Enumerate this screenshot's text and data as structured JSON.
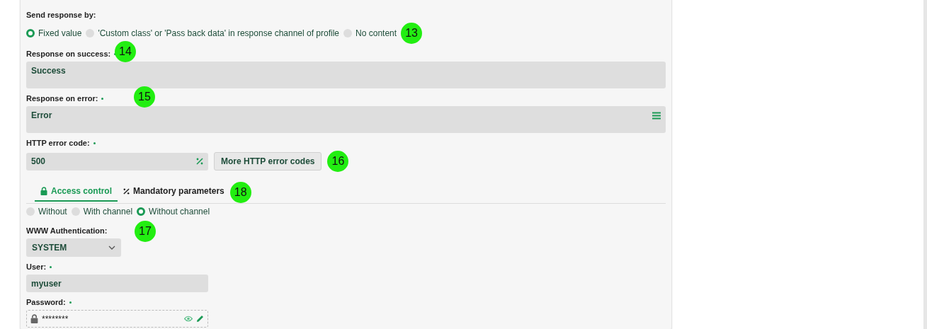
{
  "send_response": {
    "label": "Send response by:",
    "options": [
      {
        "label": "Fixed value",
        "selected": true
      },
      {
        "label": "'Custom class' or 'Pass back data' in response channel of profile",
        "selected": false
      },
      {
        "label": "No content",
        "selected": false
      }
    ]
  },
  "response_success": {
    "label": "Response on success:",
    "required": true,
    "value": "Success"
  },
  "response_error": {
    "label": "Response on error:",
    "required": true,
    "value": "Error"
  },
  "http_error_code": {
    "label": "HTTP error code:",
    "required": true,
    "value": "500",
    "button": "More HTTP error codes"
  },
  "tabs": [
    {
      "label": "Access control",
      "selected": true,
      "kind": "lock"
    },
    {
      "label": "Mandatory parameters",
      "selected": false,
      "kind": "percent"
    }
  ],
  "access_options": [
    {
      "label": "Without",
      "selected": false
    },
    {
      "label": "With channel",
      "selected": false
    },
    {
      "label": "Without channel",
      "selected": true
    }
  ],
  "www_auth": {
    "label": "WWW Authentication:",
    "value": "SYSTEM"
  },
  "user": {
    "label": "User:",
    "required": true,
    "value": "myuser"
  },
  "password": {
    "label": "Password:",
    "required": true,
    "value": "********"
  },
  "markers": [
    "13",
    "14",
    "15",
    "16",
    "18",
    "17"
  ]
}
